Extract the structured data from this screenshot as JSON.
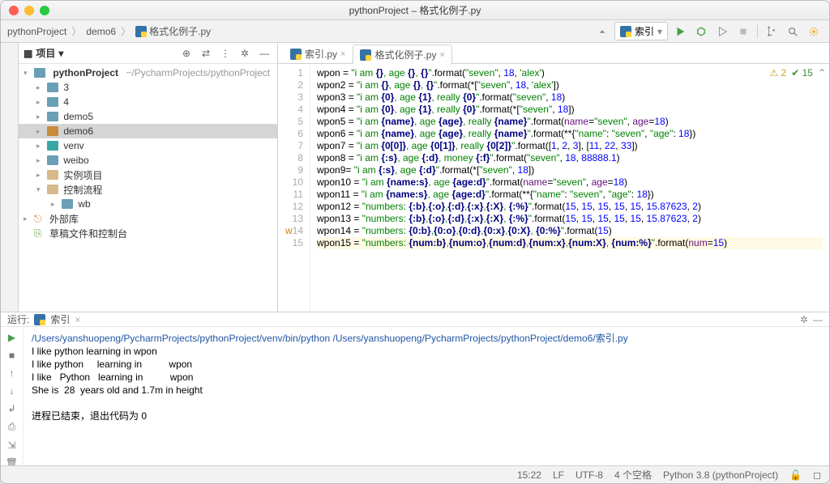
{
  "window_title": "pythonProject – 格式化例子.py",
  "breadcrumbs": [
    "pythonProject",
    "demo6",
    "格式化例子.py"
  ],
  "run_config": "索引",
  "sidebar": {
    "header": "项目",
    "root": {
      "name": "pythonProject",
      "path": "~/PycharmProjects/pythonProject"
    },
    "items": [
      "3",
      "4",
      "demo5",
      "demo6",
      "venv",
      "weibo",
      "实例项目",
      "控制流程"
    ],
    "subitem": "wb",
    "external": "外部库",
    "scratch": "草稿文件和控制台"
  },
  "tabs": [
    {
      "label": "索引.py"
    },
    {
      "label": "格式化例子.py"
    }
  ],
  "code": [
    {
      "n": 1,
      "v": "wpon",
      "s": "\"i am {}, age {}, {}\"",
      "m": ".format(",
      "a": "\"seven\", 18, 'alex'",
      "e": ")"
    },
    {
      "n": 2,
      "v": "wpon2",
      "s": "\"i am {}, age {}, {}\"",
      "m": ".format(*[",
      "a": "\"seven\", 18, 'alex'",
      "e": "])"
    },
    {
      "n": 3,
      "v": "wpon3",
      "s": "\"i am {0}, age {1}, really {0}\"",
      "m": ".format(",
      "a": "\"seven\", 18",
      "e": ")"
    },
    {
      "n": 4,
      "v": "wpon4",
      "s": "\"i am {0}, age {1}, really {0}\"",
      "m": ".format(*[",
      "a": "\"seven\", 18",
      "e": "])"
    },
    {
      "n": 5,
      "v": "wpon5",
      "s": "\"i am {name}, age {age}, really {name}\"",
      "m": ".format(",
      "a": "name=\"seven\", age=18",
      "e": ")"
    },
    {
      "n": 6,
      "v": "wpon6",
      "s": "\"i am {name}, age {age}, really {name}\"",
      "m": ".format(**{",
      "a": "\"name\": \"seven\", \"age\": 18",
      "e": "})"
    },
    {
      "n": 7,
      "v": "wpon7",
      "s": "\"i am {0[0]}, age {0[1]}, really {0[2]}\"",
      "m": ".format([",
      "a": "1, 2, 3], [11, 22, 33",
      "e": "])"
    },
    {
      "n": 8,
      "v": "wpon8",
      "s": "\"i am {:s}, age {:d}, money {:f}\"",
      "m": ".format(",
      "a": "\"seven\", 18, 88888.1",
      "e": ")"
    },
    {
      "n": 9,
      "v": "wpon9",
      "s": "\"i am {:s}, age {:d}\"",
      "m": ".format(*[",
      "a": "\"seven\", 18",
      "e": "])",
      "eq": "= "
    },
    {
      "n": 10,
      "v": "wpon10",
      "s": "\"i am {name:s}, age {age:d}\"",
      "m": ".format(",
      "a": "name=\"seven\", age=18",
      "e": ")"
    },
    {
      "n": 11,
      "v": "wpon11",
      "s": "\"i am {name:s}, age {age:d}\"",
      "m": ".format(**{",
      "a": "\"name\": \"seven\", \"age\": 18",
      "e": "})"
    },
    {
      "n": 12,
      "v": "wpon12",
      "s": "\"numbers: {:b},{:o},{:d},{:x},{:X}, {:%}\"",
      "m": ".format(",
      "a": "15, 15, 15, 15, 15, 15.87623, 2",
      "e": ")"
    },
    {
      "n": 13,
      "v": "wpon13",
      "s": "\"numbers: {:b},{:o},{:d},{:x},{:X}, {:%}\"",
      "m": ".format(",
      "a": "15, 15, 15, 15, 15, 15.87623, 2",
      "e": ")"
    },
    {
      "n": 14,
      "v": "wpon14",
      "s": "\"numbers: {0:b},{0:o},{0:d},{0:x},{0:X}, {0:%}\"",
      "m": ".format(",
      "a": "15",
      "e": ")",
      "mark": true
    },
    {
      "n": 15,
      "v": "wpon15",
      "s": "\"numbers: {num:b},{num:o},{num:d},{num:x},{num:X}, {num:%}\"",
      "m": ".format(",
      "a": "num=15",
      "e": ")",
      "hl": true
    }
  ],
  "inspection": {
    "warn": "2",
    "ok": "15"
  },
  "run_tab": {
    "label": "运行:",
    "name": "索引"
  },
  "console": {
    "cmd": "/Users/yanshuopeng/PycharmProjects/pythonProject/venv/bin/python /Users/yanshuopeng/PycharmProjects/pythonProject/demo6/索引.py",
    "lines": [
      "I like python learning in wpon",
      "I like python     learning in          wpon",
      "I like   Python   learning in          wpon",
      "She is  28  years old and 1.7m in height"
    ],
    "exit": "进程已结束，退出代码为 0"
  },
  "status": {
    "pos": "15:22",
    "eol": "LF",
    "enc": "UTF-8",
    "indent": "4 个空格",
    "sdk": "Python 3.8 (pythonProject)"
  }
}
